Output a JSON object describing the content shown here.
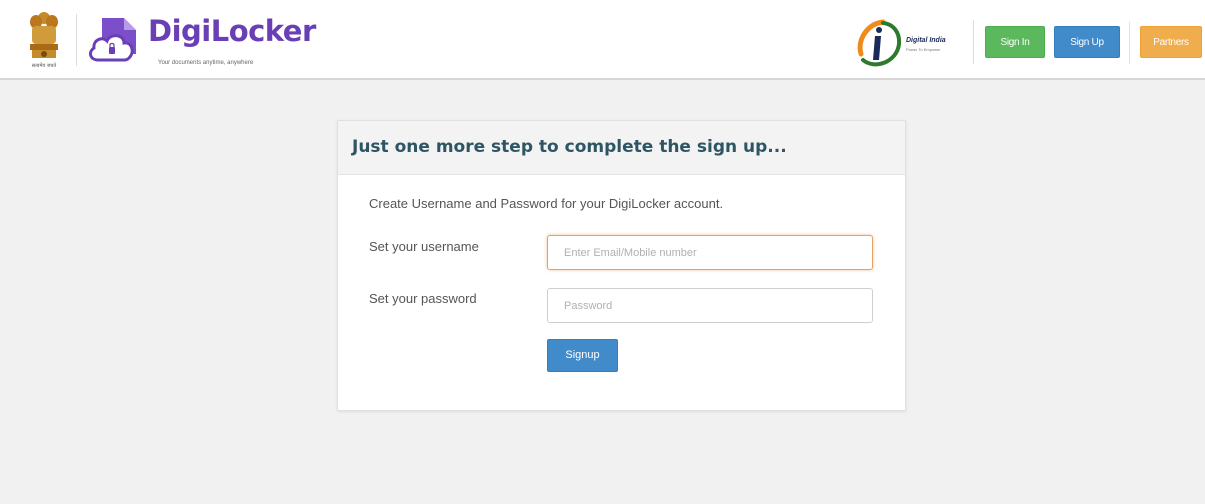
{
  "header": {
    "emblem_caption": "सत्यमेव जयते",
    "brand_name": "DigiLocker",
    "brand_tagline": "Your documents anytime, anywhere",
    "digital_india_title": "Digital India",
    "digital_india_subtitle": "Power To Empower",
    "signin_label": "Sign In",
    "signup_label": "Sign Up",
    "partners_label": "Partners"
  },
  "form": {
    "title": "Just one more step to complete the sign up...",
    "intro": "Create Username and Password for your DigiLocker account.",
    "username_label": "Set your username",
    "username_placeholder": "Enter Email/Mobile number",
    "username_value": "",
    "password_label": "Set your password",
    "password_placeholder": "Password",
    "password_value": "",
    "submit_label": "Signup"
  },
  "colors": {
    "brand_purple": "#6a3fb5",
    "signin_green": "#5cb85c",
    "signup_blue": "#428bca",
    "partners_orange": "#f0ad4e",
    "title_teal": "#2d5563"
  },
  "icons": [
    "national-emblem-icon",
    "digilocker-cloud-icon",
    "digital-india-logo-icon"
  ]
}
